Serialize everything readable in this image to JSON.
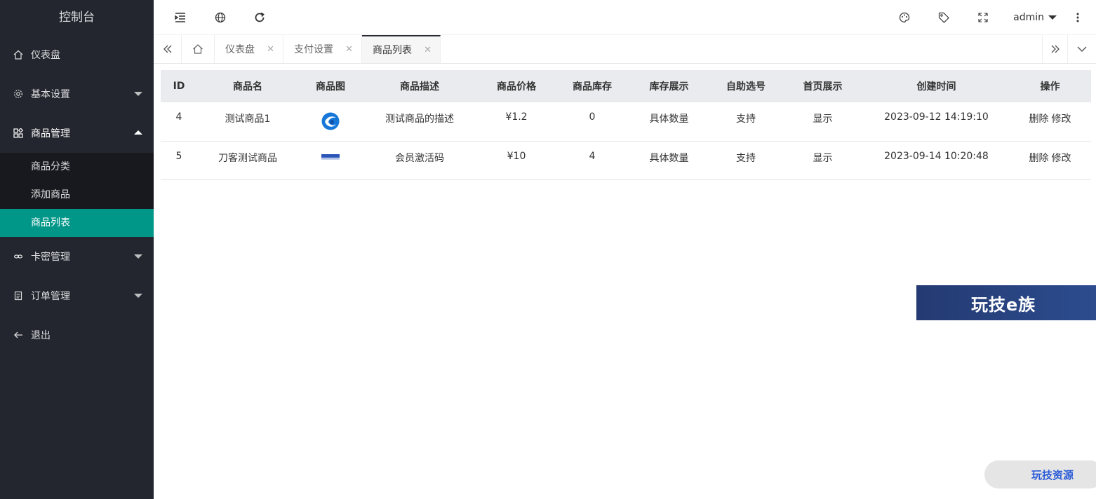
{
  "app": {
    "brand": "控制台"
  },
  "sidebar": {
    "items": [
      {
        "label": "仪表盘",
        "icon": "home-icon"
      },
      {
        "label": "基本设置",
        "icon": "gear-icon"
      },
      {
        "label": "商品管理",
        "icon": "apps-icon"
      },
      {
        "label": "卡密管理",
        "icon": "link-icon"
      },
      {
        "label": "订单管理",
        "icon": "clipboard-icon"
      },
      {
        "label": "退出",
        "icon": "arrow-left-icon"
      }
    ],
    "subitems": [
      {
        "label": "商品分类"
      },
      {
        "label": "添加商品"
      },
      {
        "label": "商品列表"
      }
    ]
  },
  "header": {
    "user": "admin"
  },
  "tabs": [
    {
      "label": "仪表盘"
    },
    {
      "label": "支付设置"
    },
    {
      "label": "商品列表"
    }
  ],
  "table": {
    "headers": [
      "ID",
      "商品名",
      "商品图",
      "商品描述",
      "商品价格",
      "商品库存",
      "库存展示",
      "自助选号",
      "首页展示",
      "创建时间",
      "操作"
    ],
    "rows": [
      {
        "id": "4",
        "name": "测试商品1",
        "desc": "测试商品的描述",
        "price": "¥1.2",
        "stock": "0",
        "stock_display": "具体数量",
        "self_select": "支持",
        "home_display": "显示",
        "created": "2023-09-12 14:19:10",
        "del": "删除",
        "edit": "修改"
      },
      {
        "id": "5",
        "name": "刀客测试商品",
        "desc": "会员激活码",
        "price": "¥10",
        "stock": "4",
        "stock_display": "具体数量",
        "self_select": "支持",
        "home_display": "显示",
        "created": "2023-09-14 10:20:48",
        "del": "删除",
        "edit": "修改"
      }
    ]
  },
  "watermarks": {
    "banner": "玩技e族",
    "corner": "玩技资源"
  },
  "colors": {
    "sidebar": "#23262e",
    "active": "#009688"
  }
}
